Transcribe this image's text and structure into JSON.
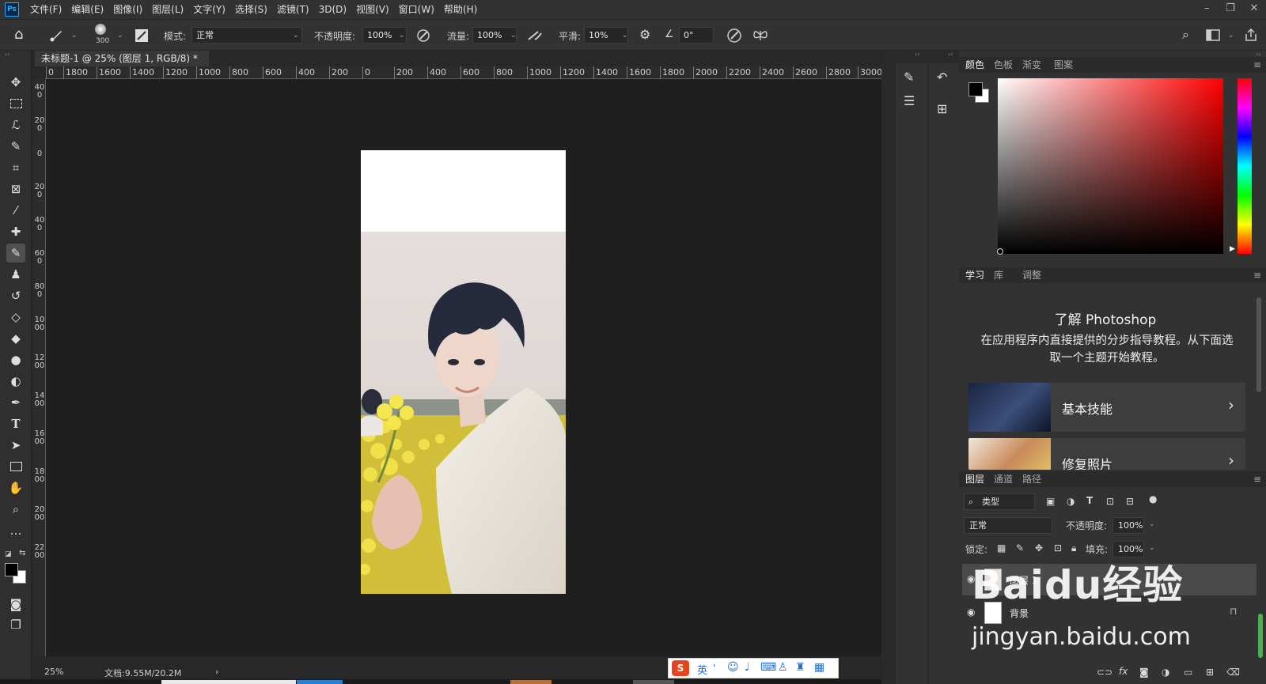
{
  "app": {
    "logo": "Ps"
  },
  "menu": [
    "文件(F)",
    "编辑(E)",
    "图像(I)",
    "图层(L)",
    "文字(Y)",
    "选择(S)",
    "滤镜(T)",
    "3D(D)",
    "视图(V)",
    "窗口(W)",
    "帮助(H)"
  ],
  "window_controls": {
    "minimize": "–",
    "restore": "❐",
    "close": "✕"
  },
  "options": {
    "brush_size": "300",
    "mode_label": "模式:",
    "mode_value": "正常",
    "opacity_label": "不透明度:",
    "opacity_value": "100%",
    "flow_label": "流量:",
    "flow_value": "100%",
    "smooth_label": "平滑:",
    "smooth_value": "10%",
    "angle_value": "0°"
  },
  "document": {
    "tab_title": "未标题-1 @ 25% (图层 1, RGB/8) *",
    "close": "×"
  },
  "ruler": {
    "h": [
      "0",
      "1800",
      "1600",
      "1400",
      "1200",
      "1000",
      "800",
      "600",
      "400",
      "200",
      "0",
      "200",
      "400",
      "600",
      "800",
      "1000",
      "1200",
      "1400",
      "1600",
      "1800",
      "2000",
      "2200",
      "2400",
      "2600",
      "2800",
      "3000"
    ],
    "v": [
      "400",
      "200",
      "0",
      "200",
      "400",
      "600",
      "800",
      "1000",
      "1200",
      "1400",
      "1600",
      "1800",
      "2000",
      "2200"
    ]
  },
  "status": {
    "zoom": "25%",
    "doc_info": "文档:9.55M/20.2M",
    "arrow": "›"
  },
  "color_panel": {
    "tabs": [
      "颜色",
      "色板",
      "渐变",
      "图案"
    ],
    "active": 0
  },
  "learn_panel": {
    "tabs": [
      "学习",
      "库",
      "调整"
    ],
    "active": 0,
    "title": "了解 Photoshop",
    "description": "在应用程序内直接提供的分步指导教程。从下面选取一个主题开始教程。",
    "cards": [
      {
        "label": "基本技能",
        "arrow": "›"
      },
      {
        "label": "修复照片",
        "arrow": "›"
      }
    ]
  },
  "layers_panel": {
    "tabs": [
      "图层",
      "通道",
      "路径"
    ],
    "active": 0,
    "filter_kind": "类型",
    "blend_mode": "正常",
    "opacity_label": "不透明度:",
    "opacity_value": "100%",
    "lock_label": "锁定:",
    "fill_label": "填充:",
    "fill_value": "100%",
    "layers": [
      {
        "name": "图层 1",
        "selected": true
      },
      {
        "name": "背景",
        "locked": true
      }
    ],
    "footer_icons": [
      "link-icon",
      "fx-icon",
      "mask-icon",
      "adjustment-icon",
      "folder-icon",
      "new-layer-icon",
      "trash-icon"
    ],
    "footer_fx": "fx"
  },
  "ime_toolbar": {
    "logo": "S",
    "lang": "英",
    "punct": "˒"
  },
  "watermark": {
    "brand": "Baidu经验",
    "url": "jingyan.baidu.com"
  },
  "colors": {
    "accent": "#31a8ff",
    "bg": "#282828",
    "panel": "#323232",
    "foreground": "#000000",
    "background": "#ffffff"
  }
}
